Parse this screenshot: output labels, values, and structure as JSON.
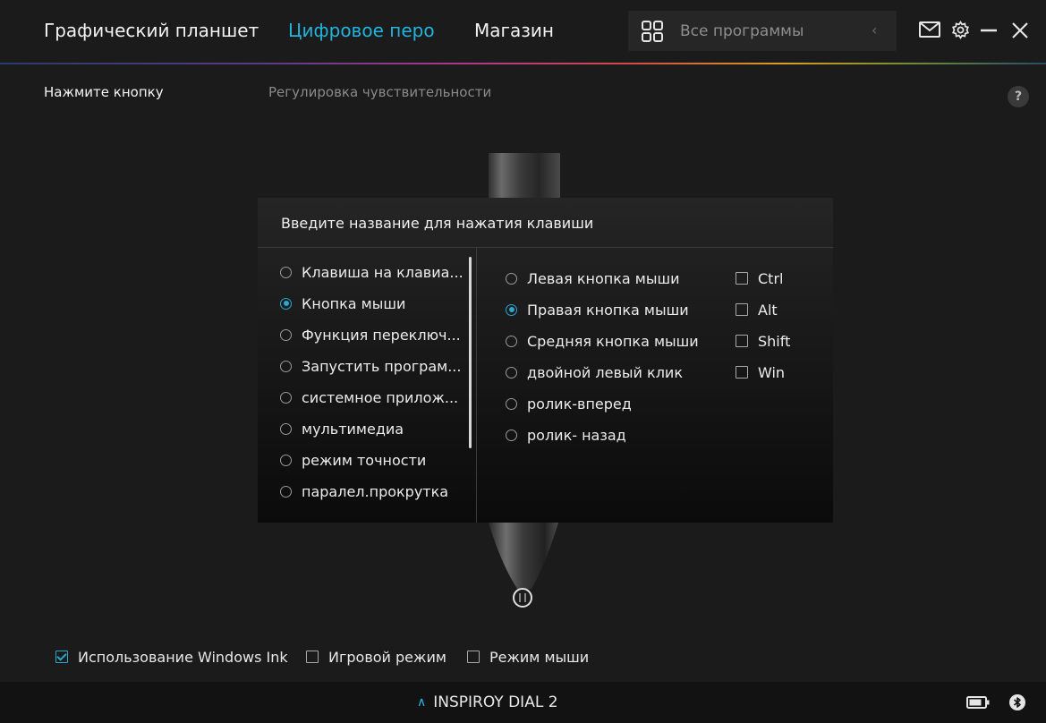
{
  "header": {
    "tabs": [
      {
        "label": "Графический планшет",
        "active": false
      },
      {
        "label": "Цифровое перо",
        "active": true
      },
      {
        "label": "Магазин",
        "active": false
      }
    ],
    "app_selector": {
      "label": "Все программы",
      "icon": "grid-icon"
    },
    "accent_color": "#23b4dc"
  },
  "subtabs": [
    {
      "label": "Нажмите кнопку",
      "active": true
    },
    {
      "label": "Регулировка чувствительности",
      "active": false
    }
  ],
  "help": "?",
  "dialog": {
    "title": "Введите название для нажатия клавиши",
    "categories": [
      {
        "label": "Клавиша на клавиа...",
        "selected": false
      },
      {
        "label": "Кнопка мыши",
        "selected": true
      },
      {
        "label": "Функция переключ...",
        "selected": false
      },
      {
        "label": "Запустить програм...",
        "selected": false
      },
      {
        "label": "системное прилож...",
        "selected": false
      },
      {
        "label": "мультимедиа",
        "selected": false
      },
      {
        "label": "режим точности",
        "selected": false
      },
      {
        "label": "паралел.прокрутка",
        "selected": false
      }
    ],
    "mouse_buttons": [
      {
        "label": "Левая кнопка мыши",
        "selected": false
      },
      {
        "label": "Правая кнопка мыши",
        "selected": true
      },
      {
        "label": "Средняя кнопка мыши",
        "selected": false
      },
      {
        "label": "двойной левый клик",
        "selected": false
      },
      {
        "label": "ролик-вперед",
        "selected": false
      },
      {
        "label": "ролик- назад",
        "selected": false
      }
    ],
    "modifiers": [
      {
        "label": "Ctrl",
        "checked": false
      },
      {
        "label": "Alt",
        "checked": false
      },
      {
        "label": "Shift",
        "checked": false
      },
      {
        "label": "Win",
        "checked": false
      }
    ]
  },
  "bottom_options": [
    {
      "label": "Использование Windows Ink",
      "checked": true
    },
    {
      "label": "Игровой режим",
      "checked": false
    },
    {
      "label": "Режим мыши",
      "checked": false
    }
  ],
  "status": {
    "device_name": "INSPIROY DIAL 2"
  }
}
